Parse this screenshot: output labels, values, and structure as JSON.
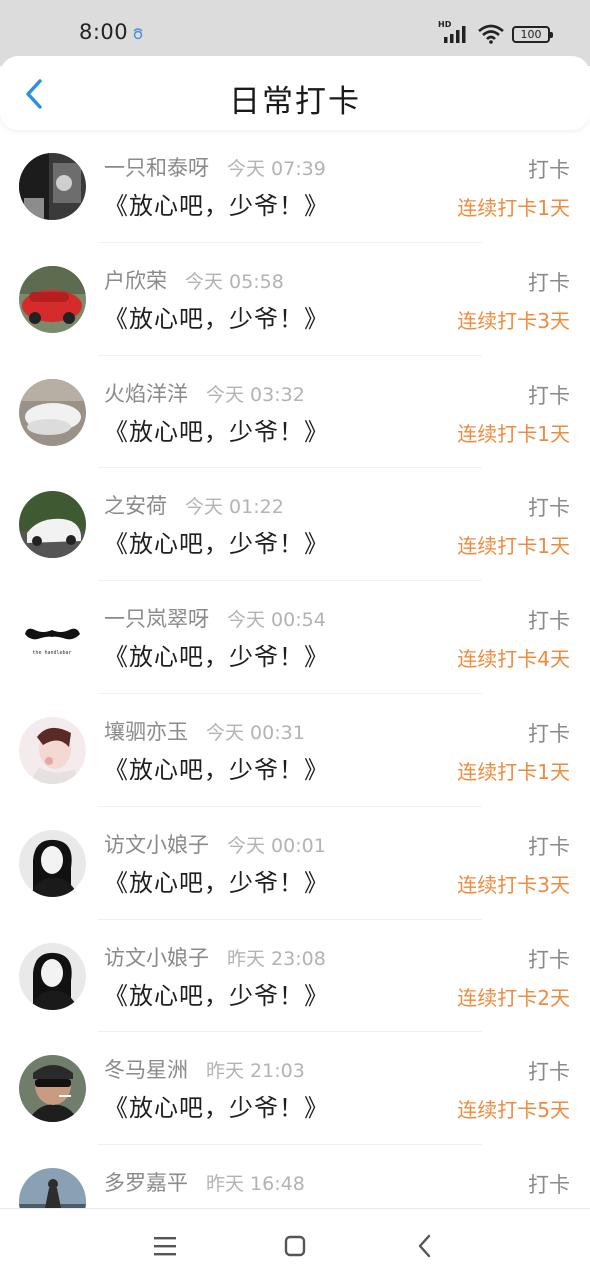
{
  "status_bar": {
    "time": "8:00",
    "network": "HD",
    "battery": "100"
  },
  "header": {
    "title": "日常打卡"
  },
  "items": [
    {
      "name": "一只和泰呀",
      "time": "今天 07:39",
      "content": "《放心吧，少爷！》",
      "action": "打卡",
      "streak": "连续打卡1天"
    },
    {
      "name": "户欣荣",
      "time": "今天 05:58",
      "content": "《放心吧，少爷！》",
      "action": "打卡",
      "streak": "连续打卡3天"
    },
    {
      "name": "火焰洋洋",
      "time": "今天 03:32",
      "content": "《放心吧，少爷！》",
      "action": "打卡",
      "streak": "连续打卡1天"
    },
    {
      "name": "之安荷",
      "time": "今天 01:22",
      "content": "《放心吧，少爷！》",
      "action": "打卡",
      "streak": "连续打卡1天"
    },
    {
      "name": "一只岚翠呀",
      "time": "今天 00:54",
      "content": "《放心吧，少爷！》",
      "action": "打卡",
      "streak": "连续打卡4天",
      "avatar_text": "the handlebar"
    },
    {
      "name": "壤驷亦玉",
      "time": "今天 00:31",
      "content": "《放心吧，少爷！》",
      "action": "打卡",
      "streak": "连续打卡1天"
    },
    {
      "name": "访文小娘子",
      "time": "今天 00:01",
      "content": "《放心吧，少爷！》",
      "action": "打卡",
      "streak": "连续打卡3天"
    },
    {
      "name": "访文小娘子",
      "time": "昨天 23:08",
      "content": "《放心吧，少爷！》",
      "action": "打卡",
      "streak": "连续打卡2天"
    },
    {
      "name": "冬马星洲",
      "time": "昨天 21:03",
      "content": "《放心吧，少爷！》",
      "action": "打卡",
      "streak": "连续打卡5天"
    },
    {
      "name": "多罗嘉平",
      "time": "昨天 16:48",
      "content": "",
      "action": "打卡",
      "streak": ""
    }
  ],
  "colors": {
    "accent": "#2f8fe0",
    "streak": "#f08a3c",
    "status_bar": "#dcdcdc"
  }
}
